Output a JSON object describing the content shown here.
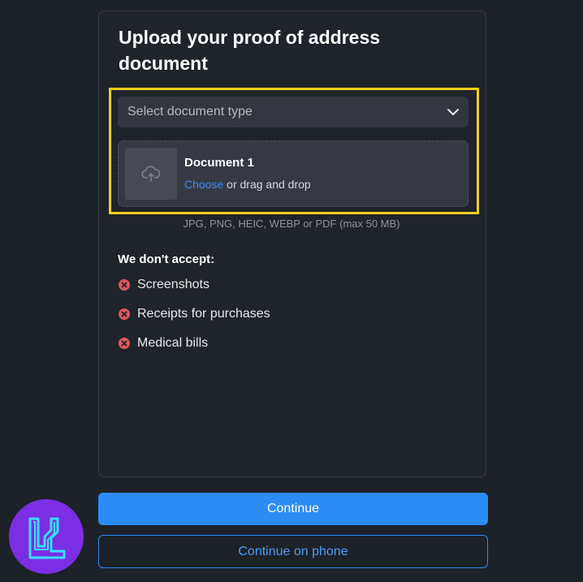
{
  "title": "Upload your proof of address document",
  "document_select": {
    "placeholder": "Select document type",
    "chevron_icon": "chevron-down-icon"
  },
  "dropzone": {
    "title": "Document 1",
    "choose_label": "Choose",
    "drag_text": " or drag and drop",
    "icon": "cloud-upload-icon"
  },
  "formats_text": "JPG, PNG, HEIC, WEBP or PDF (max 50 MB)",
  "rejections": {
    "title": "We don't accept:",
    "items": [
      "Screenshots",
      "Receipts for purchases",
      "Medical bills"
    ],
    "icon": "x-circle-icon"
  },
  "buttons": {
    "continue_label": "Continue",
    "continue_phone_label": "Continue on phone"
  },
  "colors": {
    "background": "#1d2128",
    "accent": "#2c8cf6",
    "highlight": "#f5cf1b",
    "error": "#e0555e",
    "logo": "#7b2ee3"
  }
}
